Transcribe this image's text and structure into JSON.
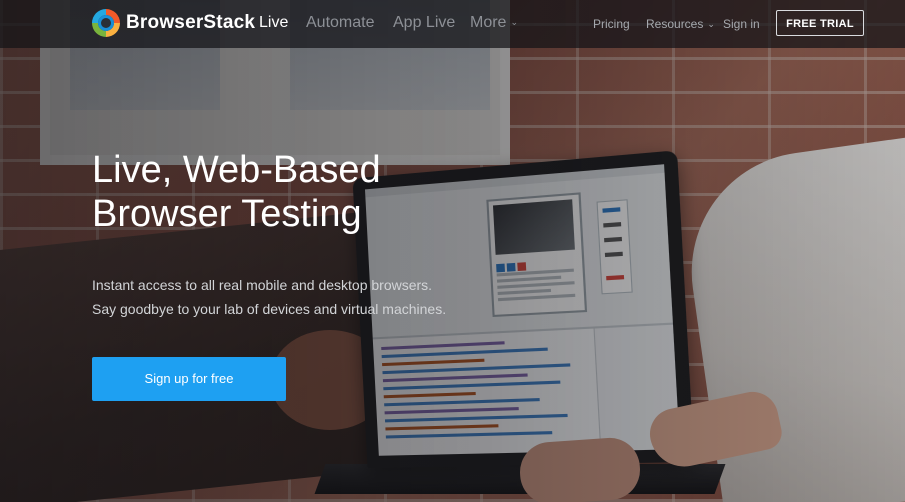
{
  "header": {
    "brand": "BrowserStack",
    "nav_primary": [
      {
        "label": "Live",
        "active": true
      },
      {
        "label": "Automate",
        "active": false
      },
      {
        "label": "App Live",
        "active": false
      },
      {
        "label": "More",
        "active": false,
        "dropdown": true
      }
    ],
    "nav_secondary": [
      {
        "label": "Pricing",
        "dropdown": false
      },
      {
        "label": "Resources",
        "dropdown": true
      },
      {
        "label": "Sign in",
        "dropdown": false
      }
    ],
    "cta_label": "FREE TRIAL"
  },
  "hero": {
    "title_line1": "Live, Web-Based",
    "title_line2": "Browser Testing",
    "subtitle_line1": "Instant access to all real mobile and desktop browsers.",
    "subtitle_line2": "Say goodbye to your lab of devices and virtual machines.",
    "button_label": "Sign up for free"
  },
  "colors": {
    "accent": "#1ea0f2",
    "header_bg": "#141418",
    "nav_dim": "#8d9096"
  },
  "icons": {
    "logo": "browserstack-logo",
    "dropdown": "chevron-down-icon"
  }
}
